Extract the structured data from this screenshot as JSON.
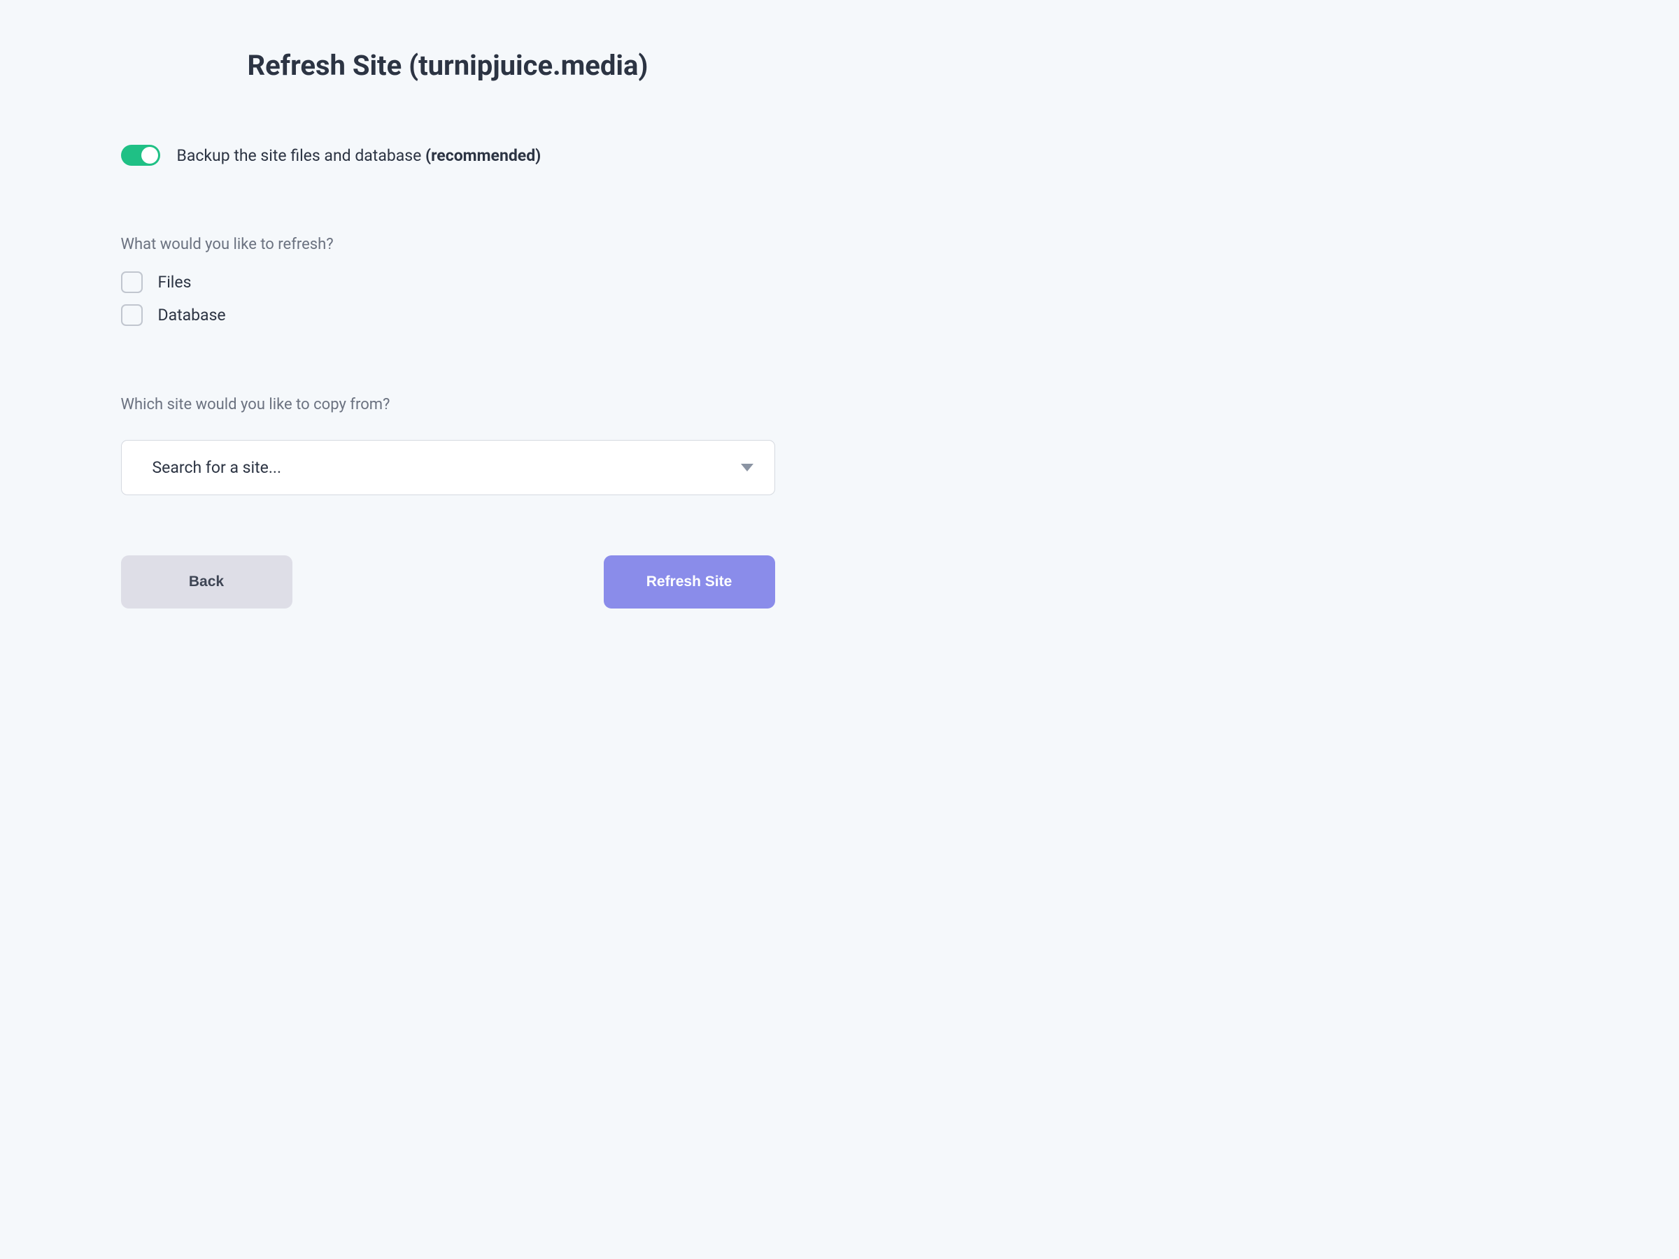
{
  "title": "Refresh Site (turnipjuice.media)",
  "backup": {
    "label_pre": "Backup the site files and database ",
    "label_strong": "(recommended)",
    "toggle_on": true
  },
  "refresh_section": {
    "label": "What would you like to refresh?",
    "options": [
      {
        "label": "Files"
      },
      {
        "label": "Database"
      }
    ]
  },
  "copy_section": {
    "label": "Which site would you like to copy from?",
    "placeholder": "Search for a site..."
  },
  "buttons": {
    "back": "Back",
    "submit": "Refresh Site"
  }
}
